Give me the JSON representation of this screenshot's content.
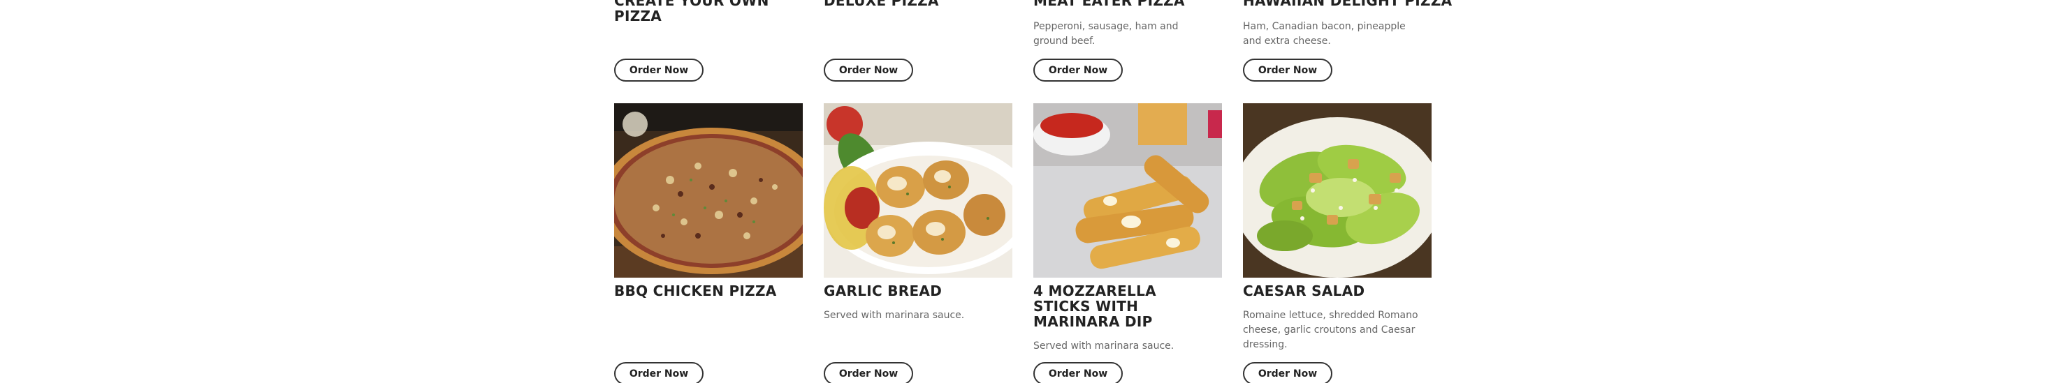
{
  "top_row": [
    {
      "title": "CREATE YOUR OWN PIZZA",
      "description": "",
      "button": "Order Now"
    },
    {
      "title": "DELUXE PIZZA",
      "description": "",
      "button": "Order Now"
    },
    {
      "title": "MEAT EATER PIZZA",
      "description": "Pepperoni, sausage, ham and ground beef.",
      "button": "Order Now"
    },
    {
      "title": "HAWAIIAN DELIGHT PIZZA",
      "description": "Ham, Canadian bacon, pineapple and extra cheese.",
      "button": "Order Now"
    }
  ],
  "bottom_row": [
    {
      "title": "BBQ CHICKEN PIZZA",
      "description": "",
      "button": "Order Now",
      "image": "bbq-chicken-pizza-photo"
    },
    {
      "title": "GARLIC BREAD",
      "description": "Served with marinara sauce.",
      "button": "Order Now",
      "image": "garlic-bread-photo"
    },
    {
      "title": "4 MOZZARELLA STICKS WITH MARINARA DIP",
      "description": "Served with marinara sauce.",
      "button": "Order Now",
      "image": "mozzarella-sticks-photo"
    },
    {
      "title": "CAESAR SALAD",
      "description": "Romaine lettuce, shredded Romano cheese, garlic croutons and Caesar dressing.",
      "button": "Order Now",
      "image": "caesar-salad-photo"
    }
  ]
}
